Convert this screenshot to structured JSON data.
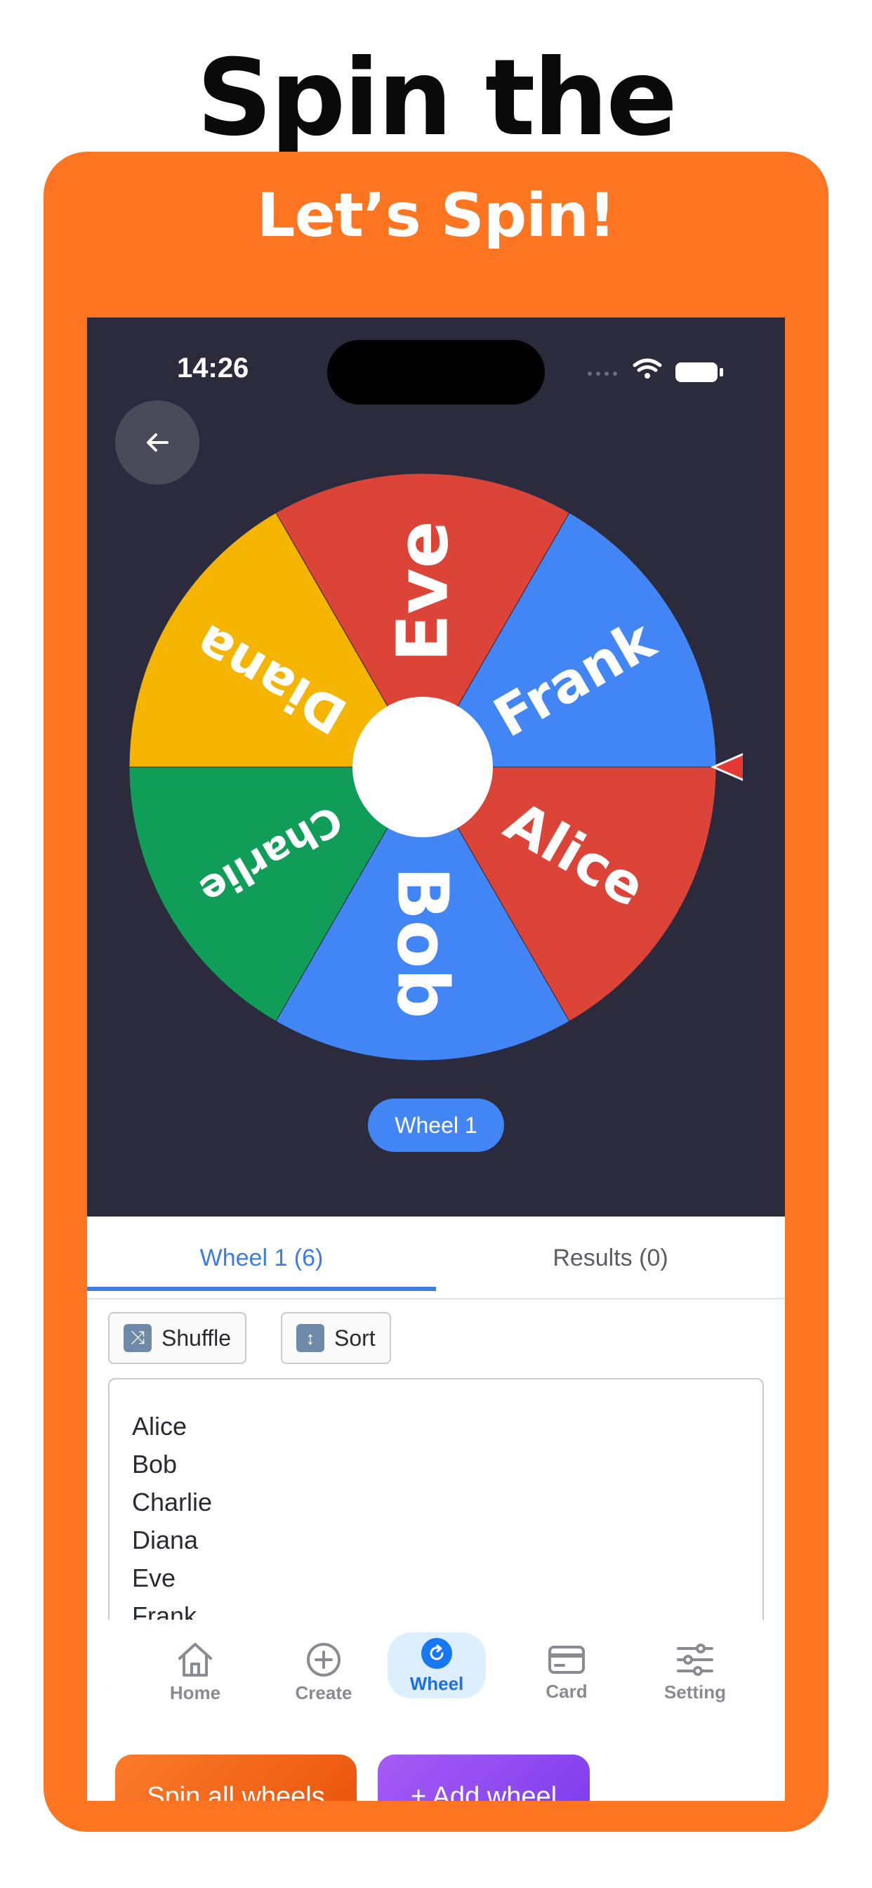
{
  "header": {
    "title": "Spin the Wheel",
    "subtitle": "Let’s Spin!"
  },
  "status_bar": {
    "time": "14:26"
  },
  "wheel": {
    "segments": [
      {
        "label": "Eve",
        "color": "#db4437"
      },
      {
        "label": "Frank",
        "color": "#4285f4"
      },
      {
        "label": "Alice",
        "color": "#db4437"
      },
      {
        "label": "Bob",
        "color": "#4285f4"
      },
      {
        "label": "Charlie",
        "color": "#0f9d58"
      },
      {
        "label": "Diana",
        "color": "#f4b400"
      }
    ],
    "name_pill": "Wheel 1"
  },
  "tabs": {
    "wheel_tab": "Wheel 1 (6)",
    "results_tab": "Results (0)"
  },
  "toolbar": {
    "shuffle": "Shuffle",
    "sort": "Sort",
    "shuffle_icon": "shuffle-icon",
    "sort_icon": "up-down-arrow-icon"
  },
  "names_list": [
    "Alice",
    "Bob",
    "Charlie",
    "Diana",
    "Eve",
    "Frank"
  ],
  "bottom_nav": {
    "home": "Home",
    "create": "Create",
    "wheel": "Wheel",
    "card": "Card",
    "setting": "Setting"
  },
  "actions": {
    "spin_all": "Spin all wheels",
    "add_wheel": "+ Add wheel"
  },
  "colors": {
    "brand_orange": "#fd7421",
    "accent_blue": "#3d7ce0",
    "dark_bg": "#2c2b3e",
    "purple": "#8b45f0"
  }
}
